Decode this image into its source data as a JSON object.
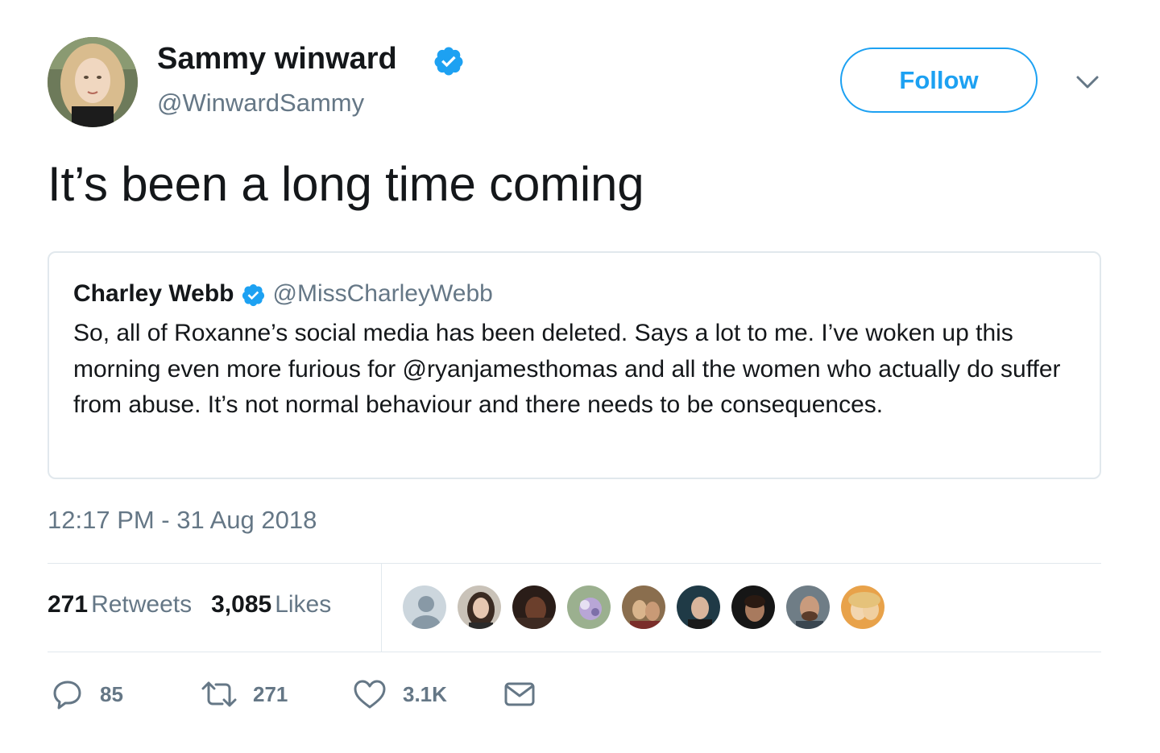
{
  "author": {
    "display_name": "Sammy winward",
    "handle": "@WinwardSammy",
    "verified": true
  },
  "follow_button": {
    "label": "Follow"
  },
  "tweet": {
    "text": "It’s been a long time coming",
    "timestamp": "12:17 PM - 31 Aug 2018"
  },
  "quote": {
    "display_name": "Charley Webb",
    "handle": "@MissCharleyWebb",
    "verified": true,
    "text": "So, all of Roxanne’s social media has been deleted. Says a lot to me. I’ve woken up this morning even more furious for @ryanjamesthomas and all the women who actually do suffer from abuse. It’s not normal behaviour and there needs to be consequences."
  },
  "stats": {
    "retweets_count": "271",
    "retweets_label": "Retweets",
    "likes_count": "3,085",
    "likes_label": "Likes"
  },
  "liker_avatars": [
    "default-avatar-icon",
    "liker-avatar",
    "liker-avatar",
    "liker-avatar",
    "liker-avatar",
    "liker-avatar",
    "liker-avatar",
    "liker-avatar",
    "liker-avatar"
  ],
  "actions": {
    "reply_count": "85",
    "retweet_count": "271",
    "like_count": "3.1K"
  },
  "colors": {
    "accent": "#1da1f2",
    "text_primary": "#14171a",
    "text_secondary": "#657786",
    "border": "#e1e8ed"
  }
}
